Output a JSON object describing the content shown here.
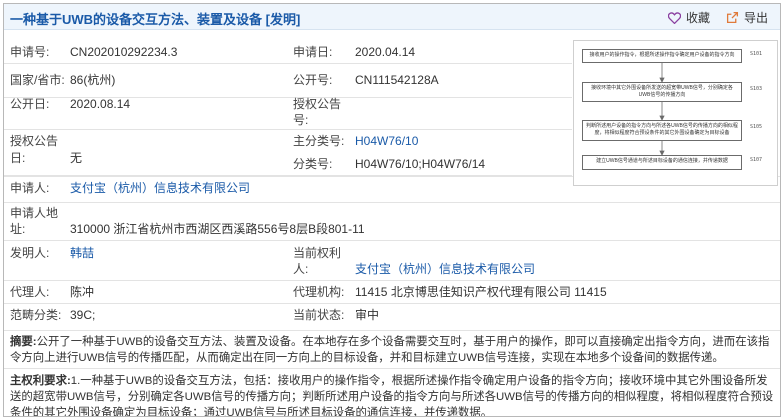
{
  "header": {
    "title": "一种基于UWB的设备交互方法、装置及设备 [发明]",
    "favorite_label": "收藏",
    "export_label": "导出"
  },
  "fields": {
    "application_no_label": "申请号:",
    "application_no": "CN202010292234.3",
    "application_date_label": "申请日:",
    "application_date": "2020.04.14",
    "country_label": "国家/省市:",
    "country": "86(杭州)",
    "publication_no_label": "公开号:",
    "publication_no": "CN111542128A",
    "publication_date_label": "公开日:",
    "publication_date": "2020.08.14",
    "grant_no_label_1": "授权公告",
    "grant_no_label_2": "号:",
    "grant_date_label_1": "授权公告",
    "grant_date_label_2": "日:",
    "grant_date": "无",
    "main_class_label": "主分类号:",
    "main_class": "H04W76/10",
    "class_label": "分类号:",
    "class_value": "H04W76/10;H04W76/14",
    "applicant_label": "申请人:",
    "applicant": "支付宝（杭州）信息技术有限公司",
    "address_label_1": "申请人地",
    "address_label_2": "址:",
    "address": "310000 浙江省杭州市西湖区西溪路556号8层B段801-11",
    "inventor_label": "发明人:",
    "inventor": "韩喆",
    "current_owner_label_1": "当前权利",
    "current_owner_label_2": "人:",
    "current_owner": "支付宝（杭州）信息技术有限公司",
    "agent_label": "代理人:",
    "agent": "陈冲",
    "agency_label": "代理机构:",
    "agency": "11415 北京博思佳知识产权代理有限公司 11415",
    "field_class_label": "范畴分类:",
    "field_class": "39C;",
    "status_label": "当前状态:",
    "status": "审中"
  },
  "figure": {
    "steps": [
      {
        "text": "接收用户的操作指令，根据所述操作指令确定用户设备的指令方向",
        "id": "S101"
      },
      {
        "text": "接收环境中其它外围设备所发送的超宽带UWB信号，分别确定各UWB信号的传播方向",
        "id": "S103"
      },
      {
        "text": "判断所述用户设备的指令方向与所述各UWB信号的传播方向的相似程度，将相似程度符合预设条件的其它外围设备确定为目标设备",
        "id": "S105"
      },
      {
        "text": "建立UWB信号通道与所述目标设备的通信连接，并传递数据",
        "id": "S107"
      }
    ]
  },
  "abstract": {
    "label": "摘要:",
    "text": "公开了一种基于UWB的设备交互方法、装置及设备。在本地存在多个设备需要交互时，基于用户的操作，即可以直接确定出指令方向，进而在该指令方向上进行UWB信号的传播匹配，从而确定出在同一方向上的目标设备，并和目标建立UWB信号连接，实现在本地多个设备间的数据传递。"
  },
  "claims": {
    "label": "主权利要求:",
    "text": "1.一种基于UWB的设备交互方法，包括：接收用户的操作指令，根据所述操作指令确定用户设备的指令方向；接收环境中其它外围设备所发送的超宽带UWB信号，分别确定各UWB信号的传播方向；判断所述用户设备的指令方向与所述各UWB信号的传播方向的相似程度，将相似程度符合预设条件的其它外围设备确定为目标设备；通过UWB信号与所述目标设备的通信连接，并传递数据。"
  },
  "colors": {
    "link": "#1a5aa8",
    "favorite_icon": "#8a3fa0",
    "export_icon": "#e07a3a"
  }
}
